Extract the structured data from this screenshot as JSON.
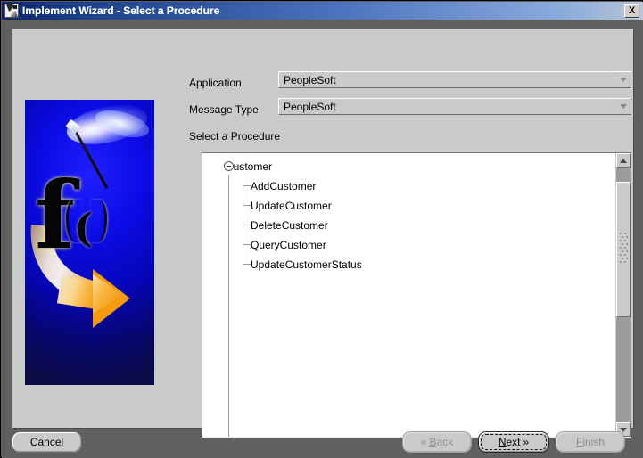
{
  "window": {
    "title": "Implement Wizard - Select a Procedure",
    "icon": "wizard-app-icon",
    "close_label": "X"
  },
  "banner": {
    "alt": "function-wizard-banner",
    "letter": "f",
    "paren_left": "(",
    "paren_right": ")",
    "bg_color": "#0b0be6",
    "accent_color": "#f59a0c"
  },
  "form": {
    "application": {
      "label": "Application",
      "value": "PeopleSoft",
      "arrow": "chevron-down-icon"
    },
    "message_type": {
      "label": "Message Type",
      "value": "PeopleSoft",
      "arrow": "chevron-down-icon"
    },
    "procedure_label": "Select a Procedure"
  },
  "tree": {
    "root": {
      "label": "Customer",
      "expanded": true,
      "toggle": "collapse-toggle-icon"
    },
    "children": [
      {
        "label": "AddCustomer"
      },
      {
        "label": "UpdateCustomer"
      },
      {
        "label": "DeleteCustomer"
      },
      {
        "label": "QueryCustomer"
      },
      {
        "label": "UpdateCustomerStatus"
      }
    ]
  },
  "scrollbar": {
    "up_icon": "scroll-up-arrow-icon",
    "down_icon": "scroll-down-arrow-icon",
    "grip": "scroll-thumb-grip"
  },
  "buttons": {
    "cancel": {
      "label": "Cancel",
      "enabled": true
    },
    "back": {
      "label": "Back",
      "mnemonic": "B",
      "prefix": "Back",
      "chevron": "«",
      "enabled": false
    },
    "next": {
      "label": "Next",
      "mnemonic": "N",
      "chevron": "»",
      "enabled": true,
      "default": true
    },
    "finish": {
      "label": "Finish",
      "mnemonic": "F",
      "enabled": false
    }
  },
  "button_text": {
    "cancel": "Cancel",
    "back_m": "B",
    "back_rest": "ack",
    "next_m": "N",
    "next_rest": "ext",
    "finish_m": "F",
    "finish_rest": "inish",
    "chev_left": "«",
    "chev_right": "»"
  }
}
